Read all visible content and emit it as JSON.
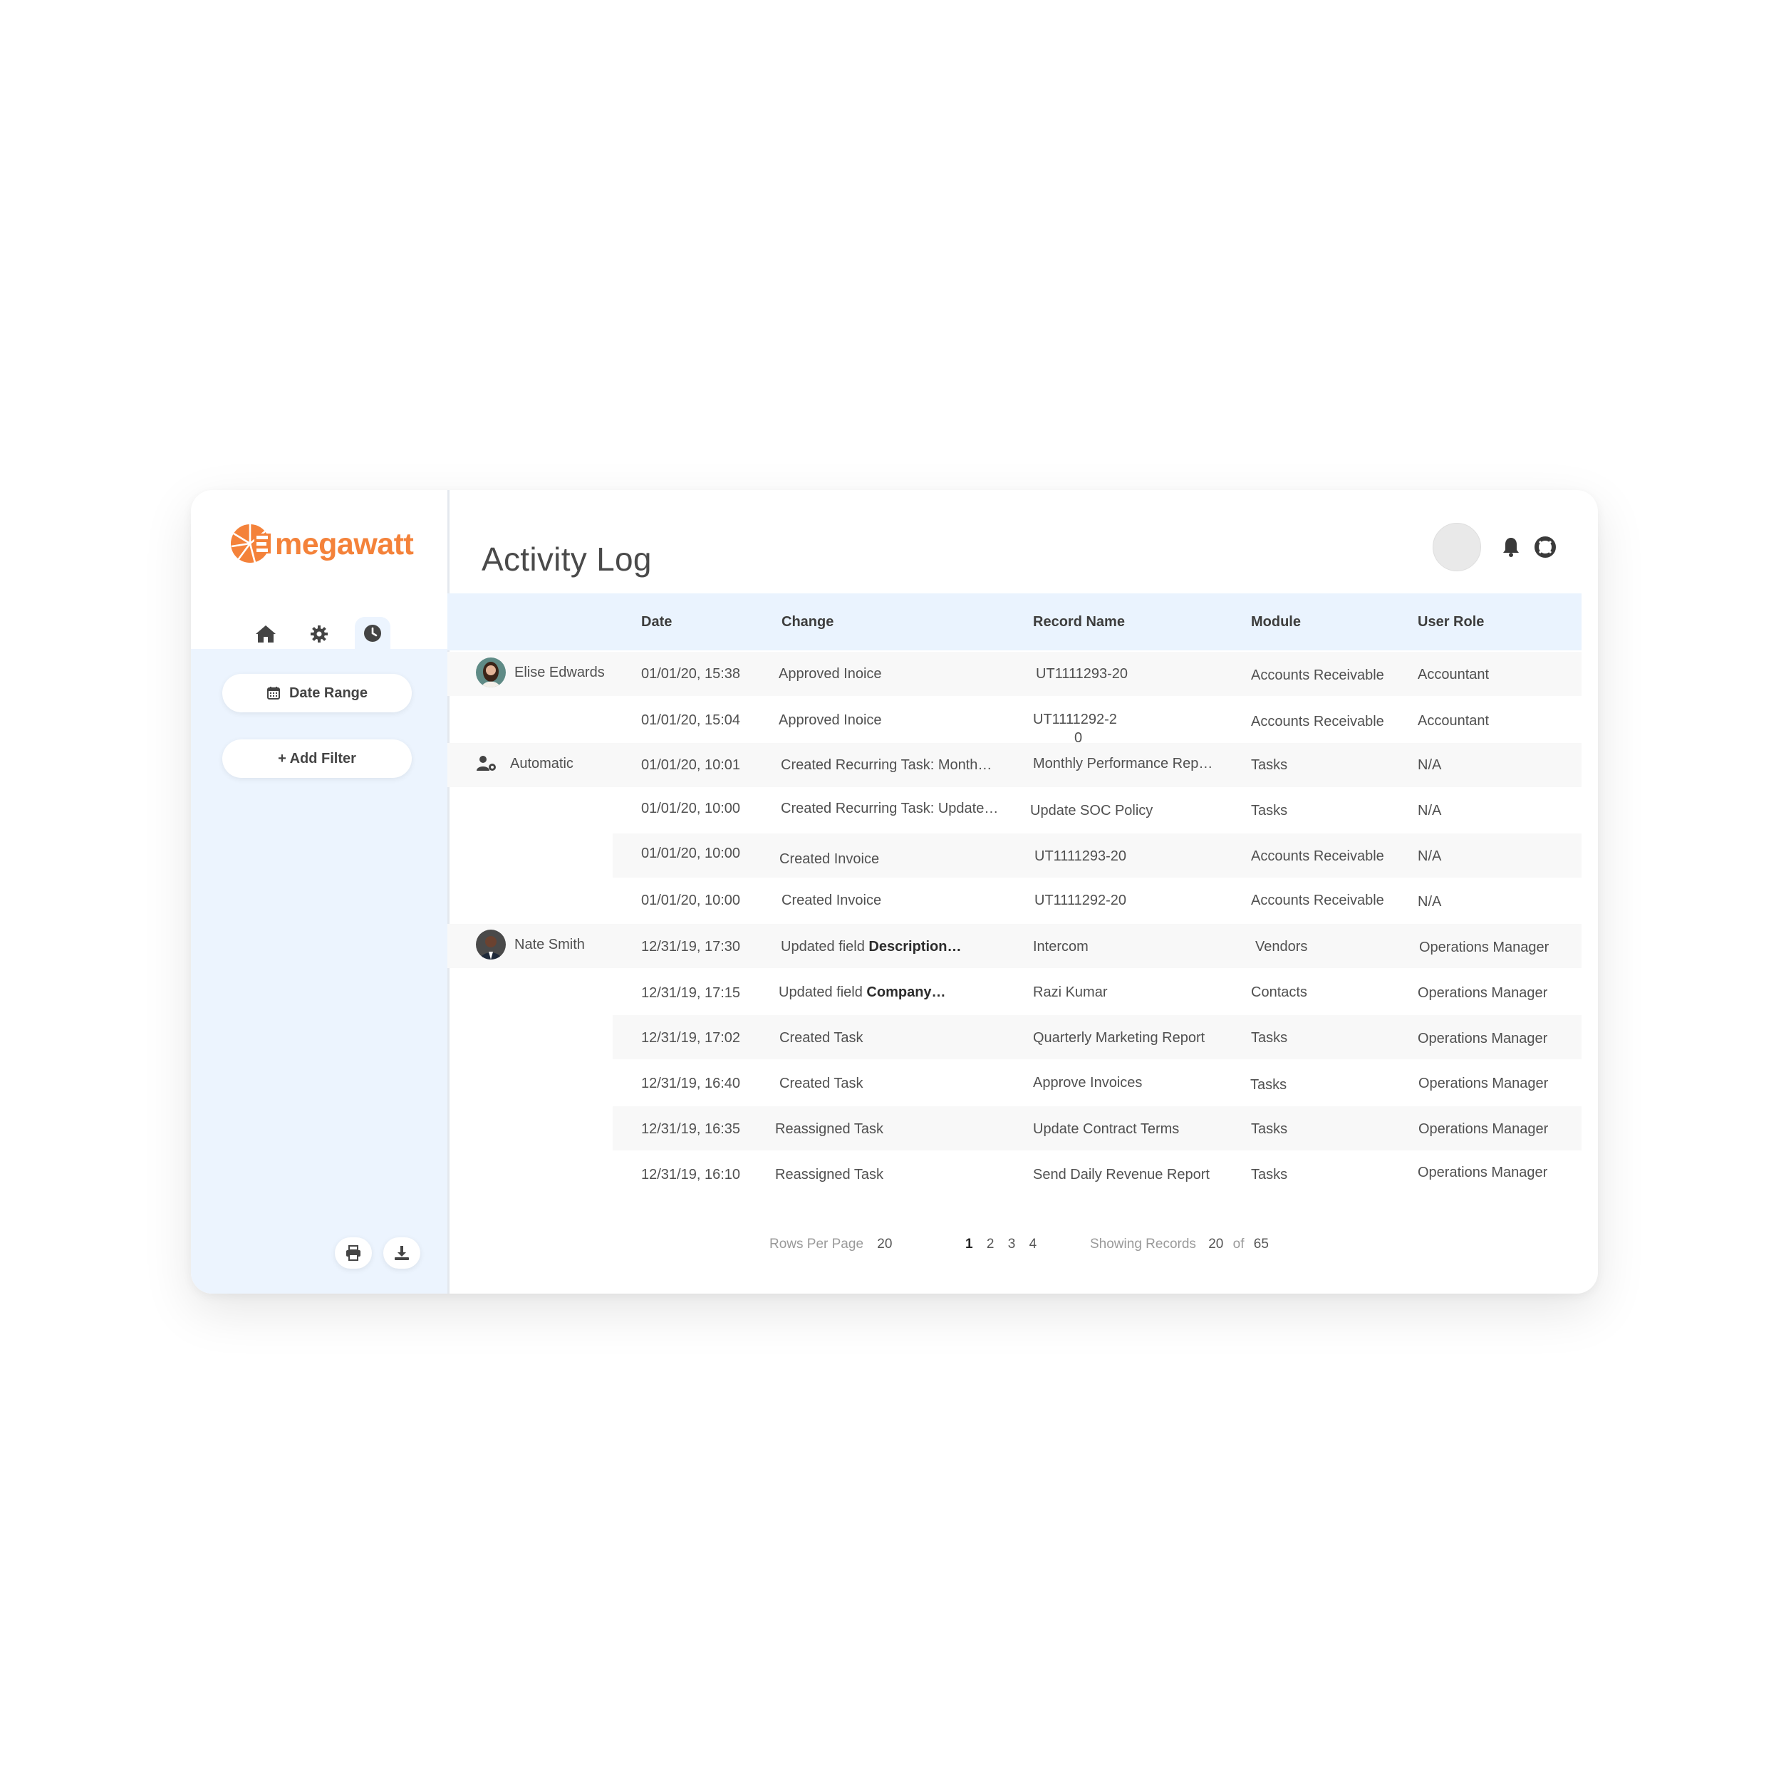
{
  "app": {
    "brand": "megawatt",
    "brand_color": "#f4823a",
    "accent_light": "#ecf4fe"
  },
  "nav": {
    "items": [
      {
        "icon": "home-icon",
        "active": false
      },
      {
        "icon": "gear-icon",
        "active": false
      },
      {
        "icon": "clock-icon",
        "active": true
      }
    ]
  },
  "sidebar": {
    "date_range_label": "Date Range",
    "add_filter_label": "+ Add Filter",
    "actions": [
      {
        "icon": "print-icon"
      },
      {
        "icon": "download-icon"
      }
    ]
  },
  "header": {
    "title": "Activity Log",
    "icons": [
      "bell-icon",
      "lifebuoy-icon"
    ]
  },
  "table": {
    "columns": [
      "Date",
      "Change",
      "Record Name",
      "Module",
      "User Role"
    ],
    "rows": [
      {
        "user": "Elise Edwards",
        "date": "01/01/20, 15:38",
        "change": "Approved Inoice",
        "change_bold": "",
        "record": "UT1111293-20",
        "module": "Accounts Receivable",
        "role": "Accountant"
      },
      {
        "user": "",
        "date": "01/01/20, 15:04",
        "change": "Approved Inoice",
        "change_bold": "",
        "record": "UT1111292-2",
        "record_wrap": "0",
        "module": "Accounts Receivable",
        "role": "Accountant"
      },
      {
        "user": "Automatic",
        "date": "01/01/20, 10:01",
        "change": "Created Recurring Task: Month…",
        "change_bold": "",
        "record": "Monthly Performance Rep…",
        "module": "Tasks",
        "role": "N/A"
      },
      {
        "user": "",
        "date": "01/01/20, 10:00",
        "change": "Created Recurring Task: Update…",
        "change_bold": "",
        "record": "Update SOC Policy",
        "module": "Tasks",
        "role": "N/A"
      },
      {
        "user": "",
        "date": "01/01/20, 10:00",
        "change": "Created Invoice",
        "change_bold": "",
        "record": "UT1111293-20",
        "module": "Accounts Receivable",
        "role": "N/A"
      },
      {
        "user": "",
        "date": "01/01/20, 10:00",
        "change": "Created Invoice",
        "change_bold": "",
        "record": "UT1111292-20",
        "module": "Accounts Receivable",
        "role": "N/A"
      },
      {
        "user": "Nate Smith",
        "date": "12/31/19, 17:30",
        "change": "Updated field ",
        "change_bold": "Description…",
        "record": "Intercom",
        "module": "Vendors",
        "role": "Operations Manager"
      },
      {
        "user": "",
        "date": "12/31/19, 17:15",
        "change": "Updated field ",
        "change_bold": "Company…",
        "record": "Razi Kumar",
        "module": "Contacts",
        "role": "Operations Manager"
      },
      {
        "user": "",
        "date": "12/31/19, 17:02",
        "change": "Created Task",
        "change_bold": "",
        "record": "Quarterly Marketing Report",
        "module": "Tasks",
        "role": "Operations Manager"
      },
      {
        "user": "",
        "date": "12/31/19, 16:40",
        "change": "Created Task",
        "change_bold": "",
        "record": "Approve Invoices",
        "module": "Tasks",
        "role": "Operations Manager"
      },
      {
        "user": "",
        "date": "12/31/19, 16:35",
        "change": "Reassigned Task",
        "change_bold": "",
        "record": "Update Contract Terms",
        "module": "Tasks",
        "role": "Operations Manager"
      },
      {
        "user": "",
        "date": "12/31/19, 16:10",
        "change": "Reassigned Task",
        "change_bold": "",
        "record": "Send Daily Revenue Report",
        "module": "Tasks",
        "role": "Operations Manager"
      }
    ]
  },
  "pagination": {
    "rows_per_page_label": "Rows Per Page",
    "rows_per_page": "20",
    "pages": [
      "1",
      "2",
      "3",
      "4"
    ],
    "current_page": "1",
    "showing_label": "Showing Records",
    "showing_count": "20",
    "of_label": "of",
    "total": "65"
  }
}
